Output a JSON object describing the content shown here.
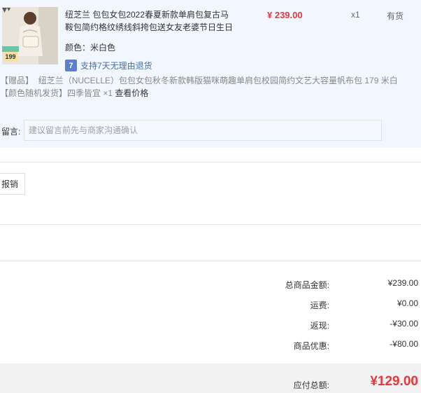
{
  "item": {
    "thumb_price_text": "199",
    "title": "纽芝兰 包包女包2022春夏新款单肩包复古马鞍包简约格纹绣线斜挎包送女友老婆节日生日",
    "price": "¥ 239.00",
    "quantity": "x1",
    "stock": "有货",
    "color_label": "颜色：米白色",
    "return_badge": "7",
    "return_text": "支持7天无理由退货",
    "gift_tag": "【赠品】",
    "gift_name": "纽芝兰（NUCELLE）包包女包秋冬新款韩版猫咪萌趣单肩包校园简约文艺大容量帆布包 179 米白",
    "gift_color_note": "【颜色随机发货】",
    "gift_suffix": "四季皆宜 ×1",
    "view_price": "查看价格",
    "note_label": "留言:",
    "note_placeholder": "建议留言前先与商家沟通确认"
  },
  "invoice": {
    "button_label": "报销"
  },
  "summary": {
    "rows": [
      {
        "label": "总商品金额:",
        "value": "¥239.00"
      },
      {
        "label": "运费:",
        "value": "¥0.00"
      },
      {
        "label": "返现:",
        "value": "-¥30.00"
      },
      {
        "label": "商品优惠:",
        "value": "-¥80.00"
      }
    ],
    "total_label": "应付总额:",
    "total_value": "¥129.00"
  },
  "colors": {
    "price_red": "#e4393c",
    "panel_bg": "#f2f7ff",
    "return_blue": "#5a7fd1"
  }
}
